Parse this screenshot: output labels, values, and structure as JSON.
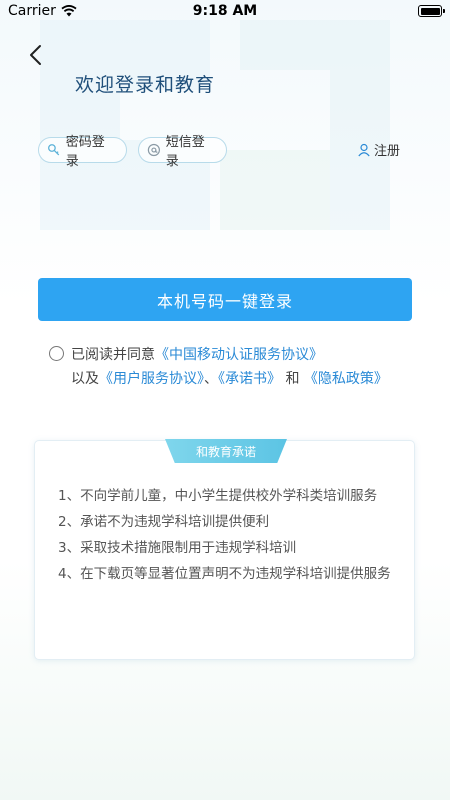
{
  "status_bar": {
    "carrier": "Carrier",
    "time": "9:18 AM"
  },
  "header": {
    "title": "欢迎登录和教育"
  },
  "login_tabs": {
    "password": "密码登录",
    "sms": "短信登录",
    "register": "注册"
  },
  "one_click_login": {
    "label": "本机号码一键登录"
  },
  "agreement": {
    "prefix": "已阅读并同意",
    "cmcc_protocol": "《中国移动认证服务协议》",
    "and_text": "以及",
    "user_protocol": "《用户服务协议》",
    "separator": "、",
    "promise_book": "《承诺书》",
    "he": "和",
    "privacy_policy": "《隐私政策》"
  },
  "promise": {
    "title": "和教育承诺",
    "items": [
      "1、不向学前儿童，中小学生提供校外学科类培训服务",
      "2、承诺不为违规学科培训提供便利",
      "3、采取技术措施限制用于违规学科培训",
      "4、在下载页等显著位置声明不为违规学科培训提供服务"
    ]
  },
  "colors": {
    "accent": "#2ea4f2",
    "link": "#2a8ad6",
    "title": "#1f4f7a",
    "tab": "#5cc4e4"
  },
  "battery_level": 1.0
}
